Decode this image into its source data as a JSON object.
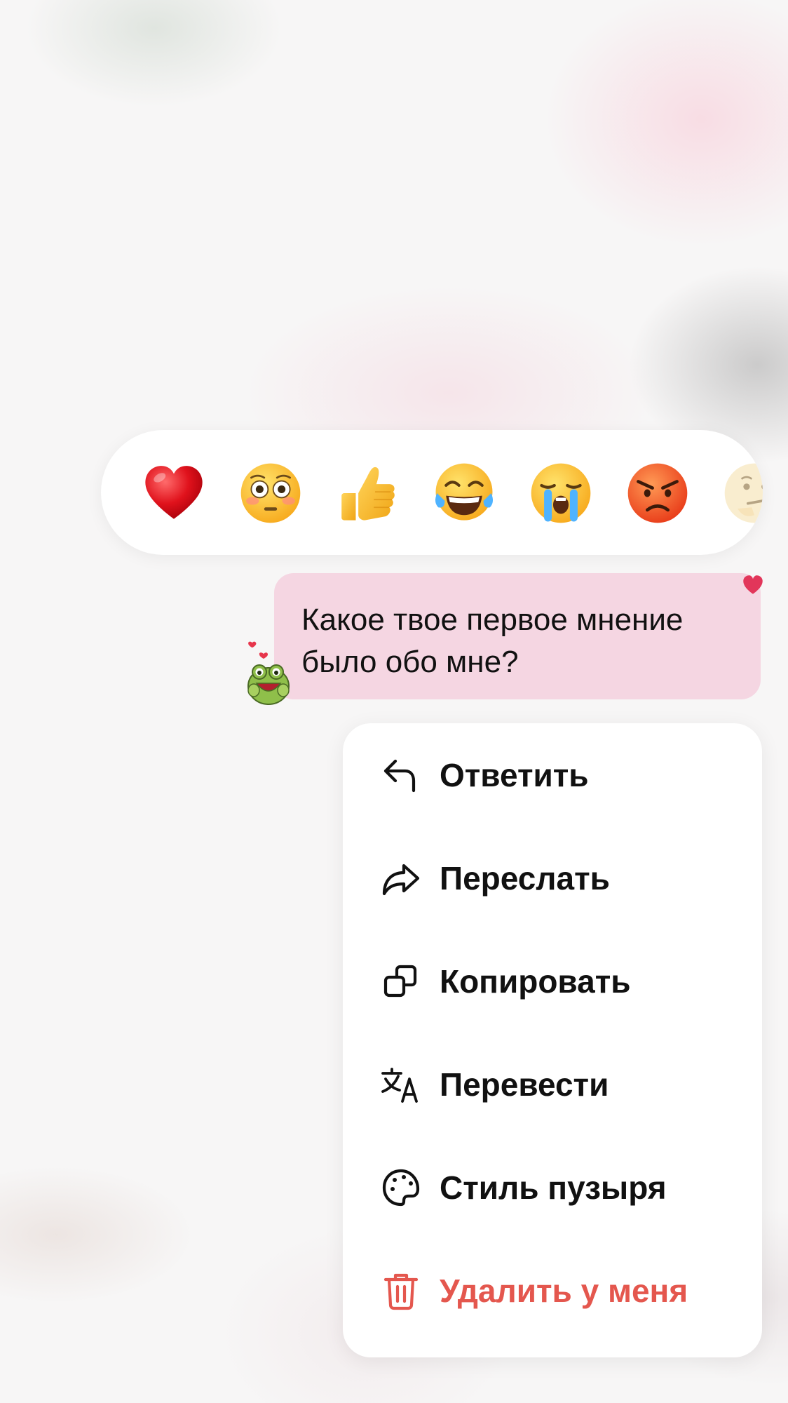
{
  "reactions": [
    {
      "name": "red-heart",
      "emoji": "❤️"
    },
    {
      "name": "flushed-face",
      "emoji": "😳"
    },
    {
      "name": "thumbs-up",
      "emoji": "👍"
    },
    {
      "name": "tears-of-joy",
      "emoji": "😂"
    },
    {
      "name": "loudly-crying-face",
      "emoji": "😭"
    },
    {
      "name": "angry-face",
      "emoji": "😡"
    },
    {
      "name": "thinking-face",
      "emoji": "🤔"
    }
  ],
  "message": {
    "text": "Какое твое первое мнение\nбыло обо мне?",
    "bubble_color": "#f5d6e2",
    "reaction_indicator": "heart-icon",
    "sticker": "frog-sticker"
  },
  "menu": {
    "items": [
      {
        "label": "Ответить",
        "icon": "reply-icon"
      },
      {
        "label": "Переслать",
        "icon": "forward-icon"
      },
      {
        "label": "Копировать",
        "icon": "copy-icon"
      },
      {
        "label": "Перевести",
        "icon": "translate-icon"
      },
      {
        "label": "Стиль пузыря",
        "icon": "palette-icon"
      },
      {
        "label": "Удалить у меня",
        "icon": "trash-icon",
        "color": "#e4574e"
      }
    ]
  },
  "colors": {
    "accent_danger": "#e4574e",
    "menu_background": "#ffffff",
    "text_primary": "#111111"
  }
}
